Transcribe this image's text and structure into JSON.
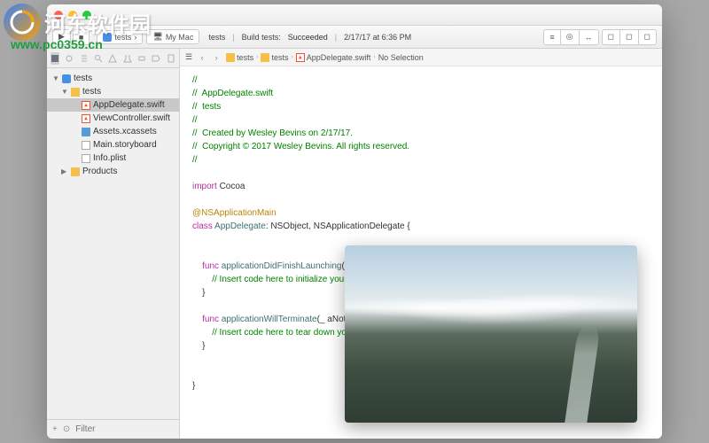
{
  "watermark": {
    "title": "河东软件园",
    "url": "www.pc0359.cn"
  },
  "toolbar": {
    "scheme_name": "tests",
    "scheme_device": "My Mac",
    "activity_target": "tests",
    "activity_text": "Build tests:",
    "activity_status": "Succeeded",
    "activity_time": "2/17/17 at 6:36 PM"
  },
  "jumpbar": {
    "segments": [
      "tests",
      "tests",
      "AppDelegate.swift",
      "No Selection"
    ]
  },
  "navigator": {
    "items": [
      {
        "label": "tests",
        "kind": "project",
        "indent": 0,
        "open": true
      },
      {
        "label": "tests",
        "kind": "folder",
        "indent": 1,
        "open": true
      },
      {
        "label": "AppDelegate.swift",
        "kind": "swift",
        "indent": 2,
        "selected": true
      },
      {
        "label": "ViewController.swift",
        "kind": "swift",
        "indent": 2
      },
      {
        "label": "Assets.xcassets",
        "kind": "assets",
        "indent": 2
      },
      {
        "label": "Main.storyboard",
        "kind": "storyboard",
        "indent": 2
      },
      {
        "label": "Info.plist",
        "kind": "plist",
        "indent": 2
      },
      {
        "label": "Products",
        "kind": "folder-y",
        "indent": 1,
        "open": false
      }
    ],
    "filter_placeholder": "Filter"
  },
  "code": {
    "c1": "//",
    "c2": "//  AppDelegate.swift",
    "c3": "//  tests",
    "c4": "//",
    "c5": "//  Created by Wesley Bevins on 2/17/17.",
    "c6": "//  Copyright © 2017 Wesley Bevins. All rights reserved.",
    "c7": "//",
    "kw_import": "import",
    "mod_cocoa": " Cocoa",
    "attr_main": "@NSApplicationMain",
    "kw_class": "class",
    "cls_name": " AppDelegate",
    "cls_rest": ": NSObject, NSApplicationDelegate {",
    "kw_func1": "    func",
    "fn1_name": " applicationDidFinishLaunching",
    "fn1_sig": "(_ aNotification: Notification) {",
    "fn1_body": "        // Insert code here to initialize your application",
    "close1": "    }",
    "kw_func2": "    func",
    "fn2_name": " applicationWillTerminate",
    "fn2_sig": "(_ aNotification: Notification) {",
    "fn2_body": "        // Insert code here to tear down your application",
    "close2": "    }",
    "close_cls": "}"
  },
  "icons": {
    "run": "▶",
    "stop": "■",
    "back": "‹",
    "fwd": "›",
    "list": "☰",
    "add": "+",
    "gear": "⚙",
    "square": "◻"
  }
}
